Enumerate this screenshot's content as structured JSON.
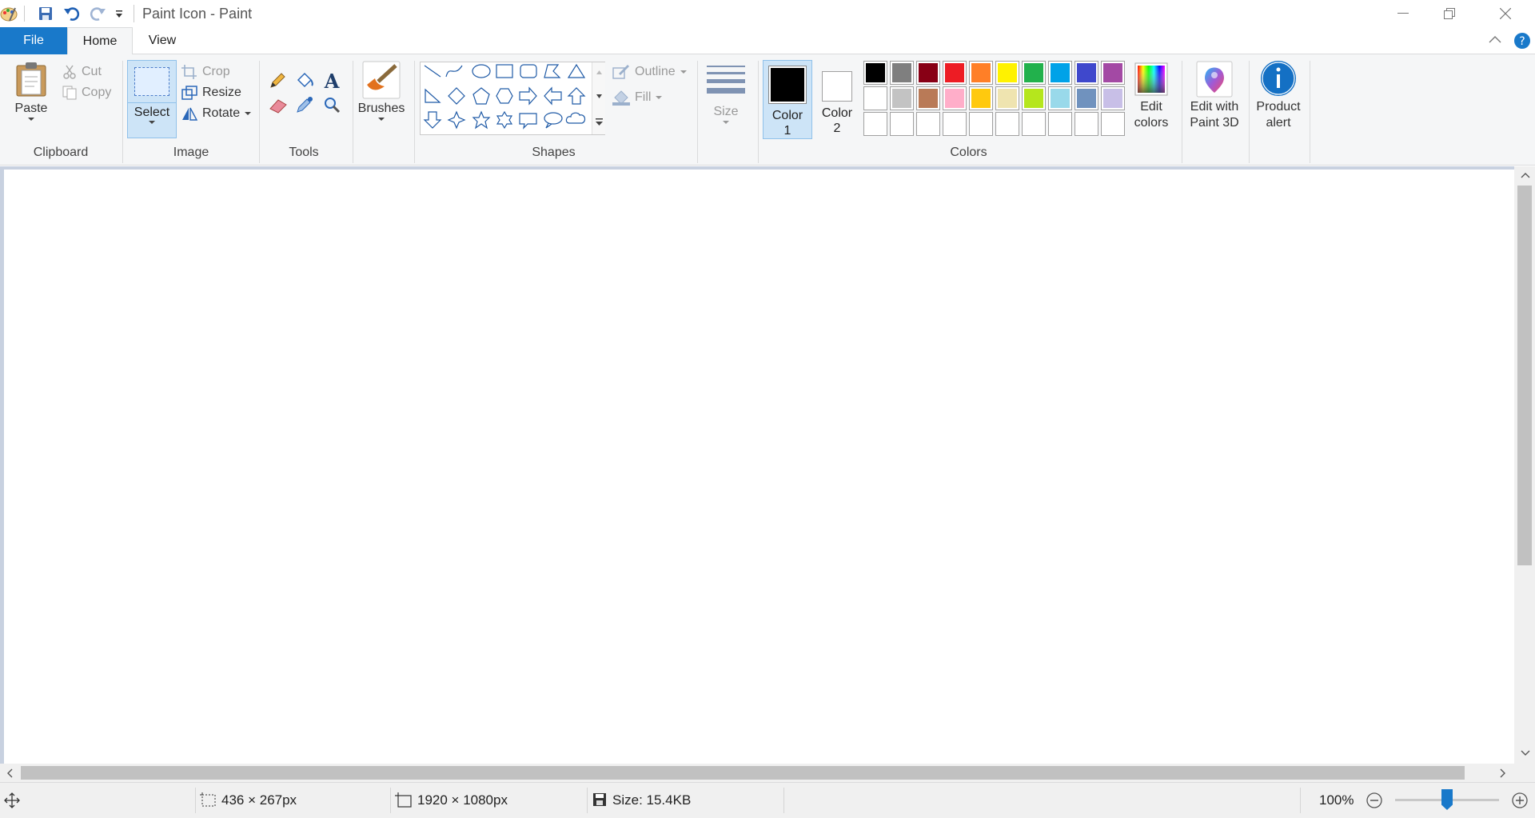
{
  "window": {
    "title": "Paint Icon - Paint"
  },
  "tabs": [
    {
      "label": "File"
    },
    {
      "label": "Home"
    },
    {
      "label": "View"
    }
  ],
  "clipboard": {
    "group_label": "Clipboard",
    "paste": "Paste",
    "cut": "Cut",
    "copy": "Copy"
  },
  "image": {
    "group_label": "Image",
    "select": "Select",
    "crop": "Crop",
    "resize": "Resize",
    "rotate": "Rotate"
  },
  "tools": {
    "group_label": "Tools"
  },
  "brushes": {
    "label": "Brushes"
  },
  "shapes": {
    "group_label": "Shapes",
    "outline": "Outline",
    "fill": "Fill"
  },
  "size": {
    "label": "Size"
  },
  "colors": {
    "group_label": "Colors",
    "color1_line1": "Color",
    "color1_line2": "1",
    "color2_line1": "Color",
    "color2_line2": "2",
    "color1": "#000000",
    "color2": "#ffffff",
    "palette_row1": [
      "#000000",
      "#7f7f7f",
      "#880015",
      "#ed1c24",
      "#ff7f27",
      "#fff200",
      "#22b14c",
      "#00a2e8",
      "#3f48cc",
      "#a349a4"
    ],
    "palette_row2": [
      "#ffffff",
      "#c3c3c3",
      "#b97a57",
      "#ffaec9",
      "#ffc90e",
      "#efe4b0",
      "#b5e61d",
      "#99d9ea",
      "#7092be",
      "#c8bfe7"
    ],
    "edit_colors_line1": "Edit",
    "edit_colors_line2": "colors"
  },
  "paint3d": {
    "line1": "Edit with",
    "line2": "Paint 3D"
  },
  "alert": {
    "line1": "Product",
    "line2": "alert"
  },
  "status": {
    "selection": "436 × 267px",
    "image_size": "1920 × 1080px",
    "file_size": "Size: 15.4KB",
    "zoom": "100%"
  }
}
